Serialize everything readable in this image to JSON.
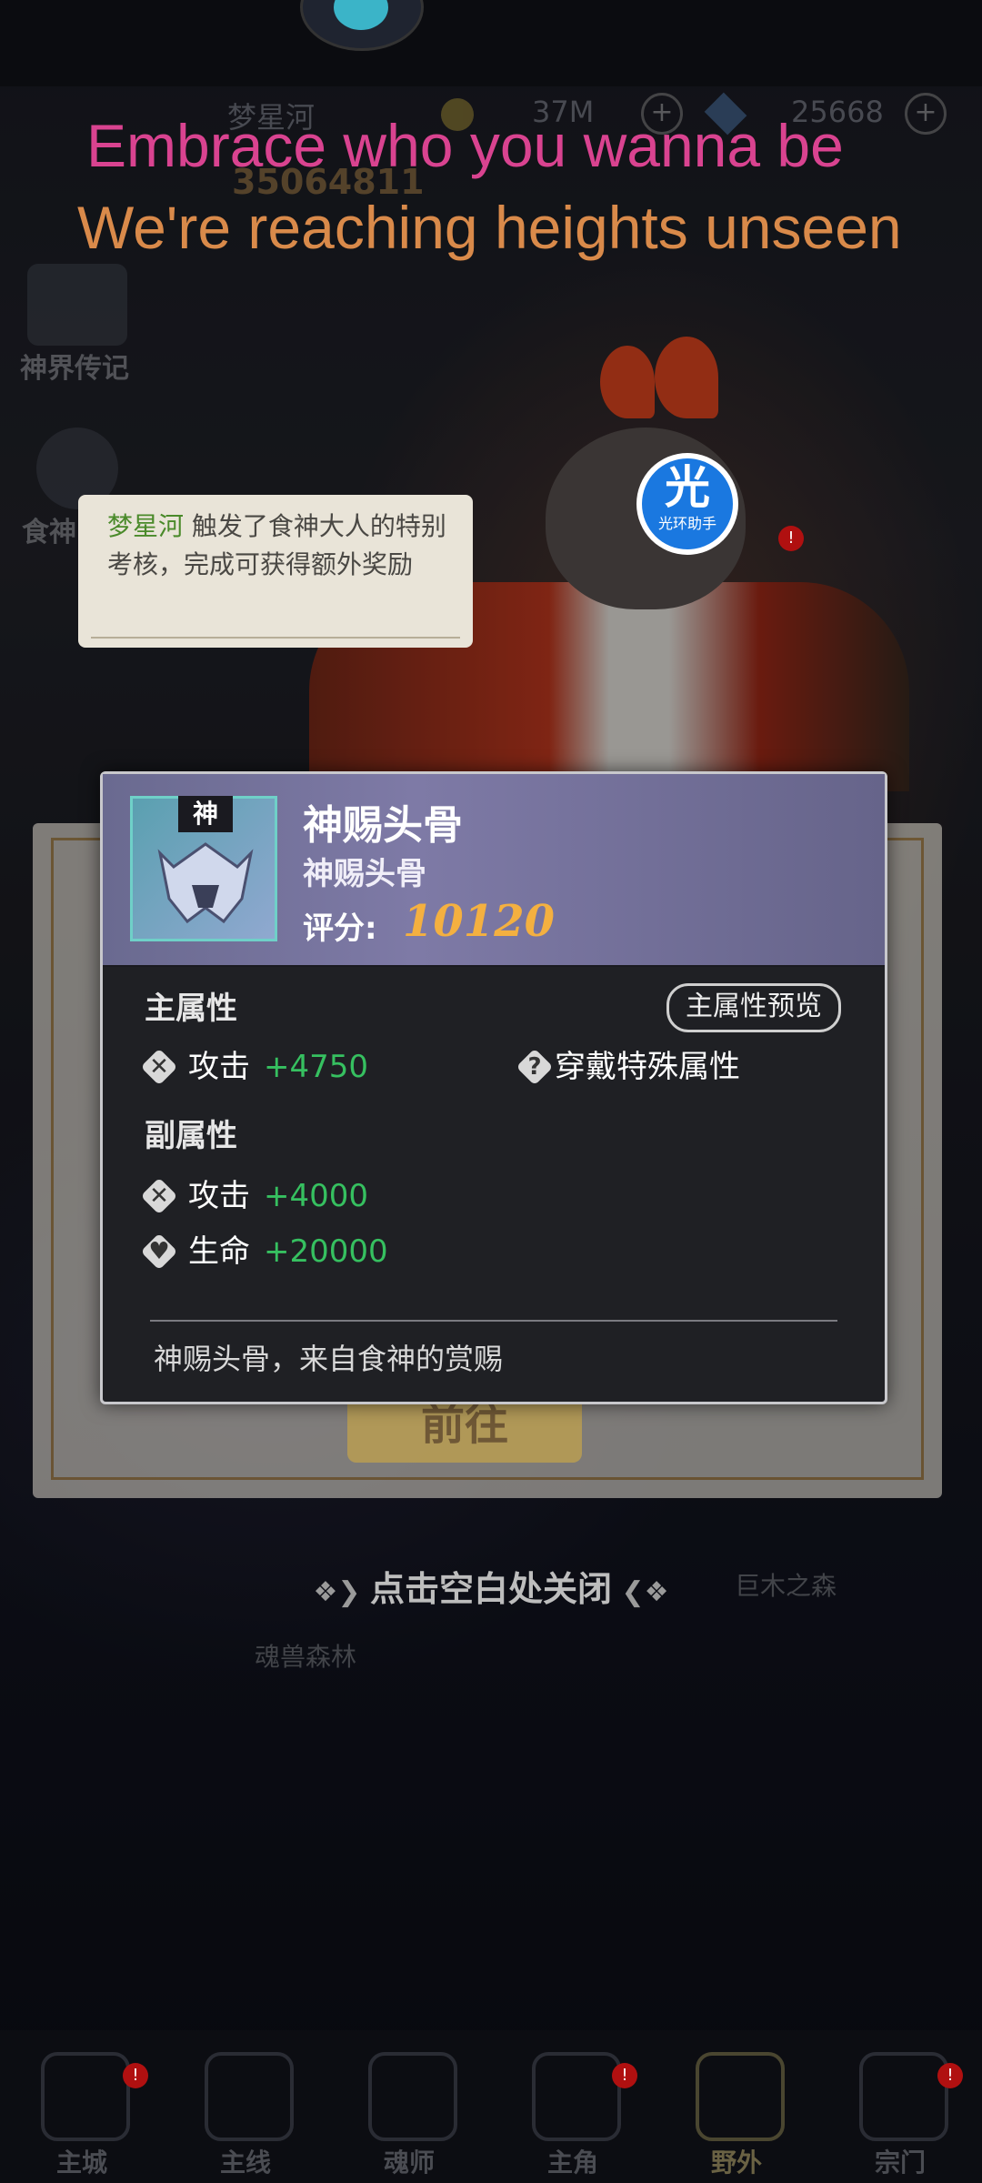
{
  "top": {
    "player_name": "梦星河",
    "gold": "37M",
    "diamonds": "25668",
    "power": "35064811"
  },
  "side": {
    "legend_label": "神界传记",
    "food_god_label": "食神"
  },
  "lyrics": {
    "line1": "Embrace who you wanna be",
    "line2": "We're reaching heights unseen"
  },
  "helper": {
    "big": "光",
    "small": "光环助手"
  },
  "bubble": {
    "name": "梦星河",
    "text": " 触发了食神大人的特别考核，完成可获得额外奖励"
  },
  "item": {
    "badge": "神",
    "title": "神赐头骨",
    "subtitle": "神赐头骨",
    "score_label": "评分:",
    "score": "10120",
    "main_section": "主属性",
    "preview_button": "主属性预览",
    "main_attrs": [
      {
        "icon": "sword-icon",
        "name": "攻击",
        "value": "+4750"
      }
    ],
    "special_attr": {
      "icon": "question-icon",
      "name": "穿戴特殊属性"
    },
    "sub_section": "副属性",
    "sub_attrs": [
      {
        "icon": "sword-icon",
        "name": "攻击",
        "value": "+4000"
      },
      {
        "icon": "heart-icon",
        "name": "生命",
        "value": "+20000"
      }
    ],
    "description": "神赐头骨，来自食神的赏赐"
  },
  "back_panel": {
    "goto_label": "前往"
  },
  "close_hint": "点击空白处关闭",
  "map_labels": {
    "soul_forest": "魂兽森林",
    "giant_forest": "巨木之森"
  },
  "nav": [
    {
      "label": "主城",
      "badge": true
    },
    {
      "label": "主线",
      "badge": false
    },
    {
      "label": "魂师",
      "badge": false
    },
    {
      "label": "主角",
      "badge": true
    },
    {
      "label": "野外",
      "badge": false,
      "active": true
    },
    {
      "label": "宗门",
      "badge": true
    }
  ],
  "colors": {
    "lyric1": "#d94390",
    "lyric2": "#d98a4a",
    "attr_value": "#36c060",
    "score": "#f4b040"
  }
}
